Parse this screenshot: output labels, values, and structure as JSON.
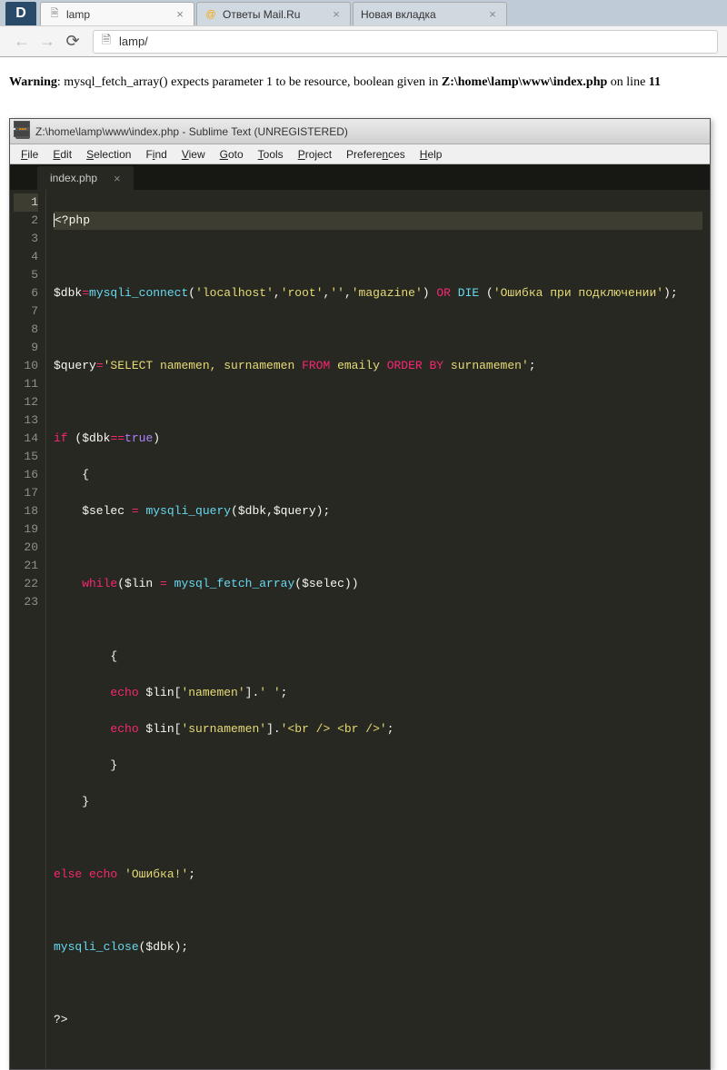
{
  "browser": {
    "site_badge": "D",
    "tabs": [
      {
        "title": "lamp",
        "active": true
      },
      {
        "title": "Ответы Mail.Ru",
        "active": false
      },
      {
        "title": "Новая вкладка",
        "active": false
      }
    ],
    "url": "lamp/"
  },
  "page": {
    "warning_label": "Warning",
    "warning_text_1": ": mysql_fetch_array() expects parameter 1 to be resource, boolean given in ",
    "warning_path": "Z:\\home\\lamp\\www\\index.php",
    "warning_text_2": " on line ",
    "warning_line": "11"
  },
  "editor": {
    "title": "Z:\\home\\lamp\\www\\index.php - Sublime Text (UNREGISTERED)",
    "menus": [
      "File",
      "Edit",
      "Selection",
      "Find",
      "View",
      "Goto",
      "Tools",
      "Project",
      "Preferences",
      "Help"
    ],
    "tab_name": "index.php",
    "line_count": 23,
    "highlight_line": 1,
    "code": {
      "l1": "<?php",
      "l2": "",
      "l3a": "$dbk",
      "l3b": "=",
      "l3c": "mysqli_connect",
      "l3d": "(",
      "l3e": "'localhost'",
      "l3f": ",",
      "l3g": "'root'",
      "l3h": "','",
      "l3i": "'magazine'",
      "l3j": ") ",
      "l3k": "OR",
      "l3l": " DIE ",
      "l3m": "(",
      "l3n": "'Ошибка при подключении'",
      "l3o": ");",
      "l5a": "$query",
      "l5b": "=",
      "l5c": "'SELECT namemen, surnamemen ",
      "l5d": "FROM",
      "l5e": " emaily ",
      "l5f": "ORDER BY",
      "l5g": " surnamemen'",
      "l5h": ";",
      "l7a": "if",
      "l7b": " (",
      "l7c": "$dbk",
      "l7d": "==",
      "l7e": "true",
      "l7f": ")",
      "l8": "    {",
      "l9a": "    $selec ",
      "l9b": "=",
      "l9c": " mysqli_query",
      "l9d": "($dbk,$query);",
      "l11a": "    while",
      "l11b": "($lin ",
      "l11c": "=",
      "l11d": " mysql_fetch_array",
      "l11e": "($selec))",
      "l13": "        {",
      "l14a": "        echo",
      "l14b": " $lin[",
      "l14c": "'namemen'",
      "l14d": "].",
      "l14e": "' '",
      "l14f": ";",
      "l15a": "        echo",
      "l15b": " $lin[",
      "l15c": "'surnamemen'",
      "l15d": "].",
      "l15e": "'<br /> <br />'",
      "l15f": ";",
      "l16": "        }",
      "l17": "    }",
      "l19a": "else",
      "l19b": " echo",
      "l19c": " 'Ошибка!'",
      "l19d": ";",
      "l21a": "mysqli_close",
      "l21b": "($dbk);",
      "l23": "?>"
    }
  }
}
